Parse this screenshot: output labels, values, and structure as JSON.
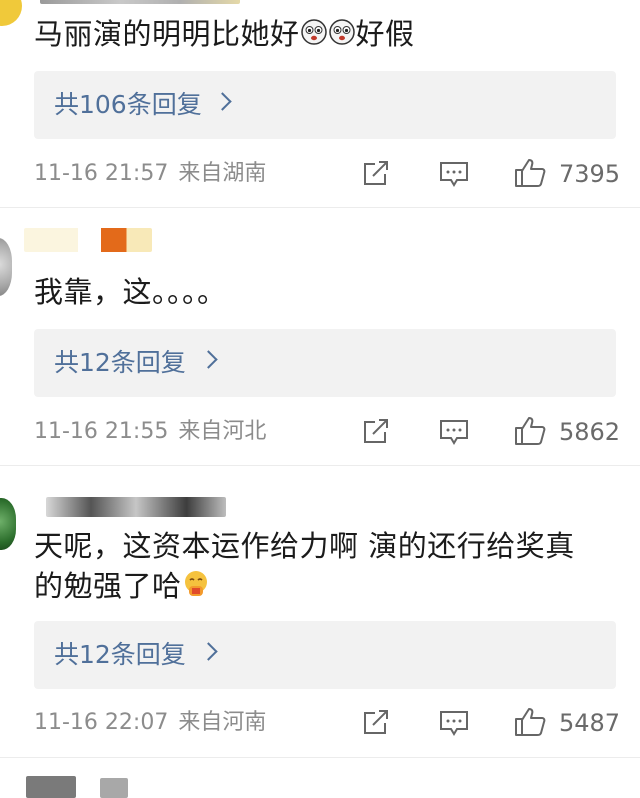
{
  "comments": [
    {
      "text": "马丽演的明明比她好",
      "text_after_emoji": "好假",
      "emoji": [
        "crying-face-icon",
        "crying-face-icon"
      ],
      "replies_label": "共106条回复",
      "time": "11-16 21:57",
      "location": "来自湖南",
      "likes": "7395"
    },
    {
      "text": "我靠，这。。。。",
      "replies_label": "共12条回复",
      "time": "11-16 21:55",
      "location": "来自河北",
      "likes": "5862"
    },
    {
      "text_line1": "天呢，这资本运作给力啊 演的还行给奖真",
      "text_line2": "的勉强了哈",
      "emoji": [
        "hand-over-mouth-icon"
      ],
      "replies_label": "共12条回复",
      "time": "11-16 22:07",
      "location": "来自河南",
      "likes": "5487"
    }
  ],
  "colors": {
    "reply_link": "#50709a",
    "reply_box_bg": "#f2f2f2",
    "meta_text": "#8c8c8c"
  }
}
